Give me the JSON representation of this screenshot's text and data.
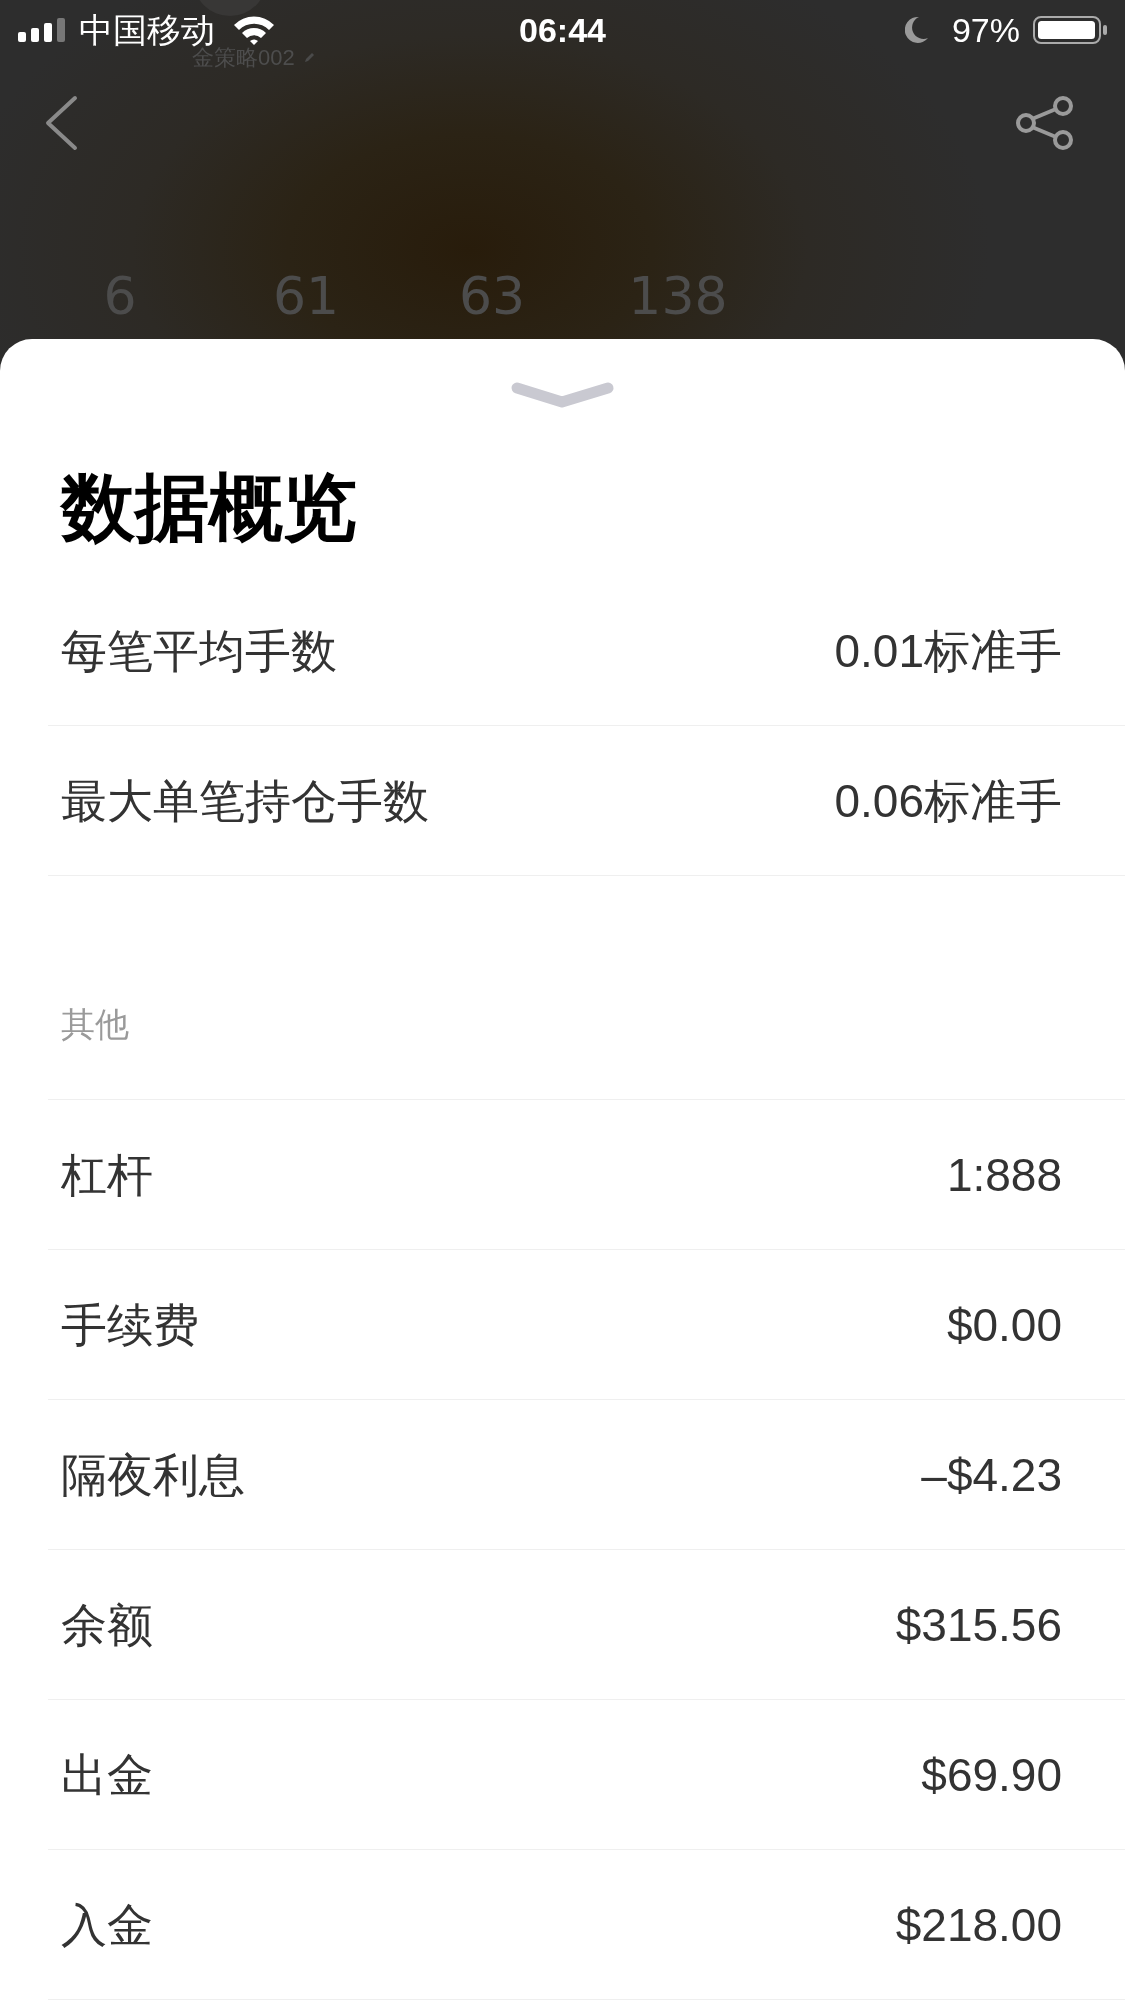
{
  "status_bar": {
    "carrier": "中国移动",
    "time": "06:44",
    "battery": "97%"
  },
  "header": {
    "subtitle": "金策略002",
    "stats": [
      "6",
      "61",
      "63",
      "138"
    ]
  },
  "sheet": {
    "title": "数据概览",
    "rows": [
      {
        "label": "每笔平均手数",
        "value": "0.01标准手"
      },
      {
        "label": "最大单笔持仓手数",
        "value": "0.06标准手"
      }
    ],
    "sections": [
      {
        "heading": "其他",
        "rows": [
          {
            "label": "杠杆",
            "value": "1:888"
          },
          {
            "label": "手续费",
            "value": "$0.00"
          },
          {
            "label": "隔夜利息",
            "value": "–$4.23"
          },
          {
            "label": "余额",
            "value": "$315.56"
          },
          {
            "label": "出金",
            "value": "$69.90"
          },
          {
            "label": "入金",
            "value": "$218.00"
          }
        ]
      }
    ]
  }
}
